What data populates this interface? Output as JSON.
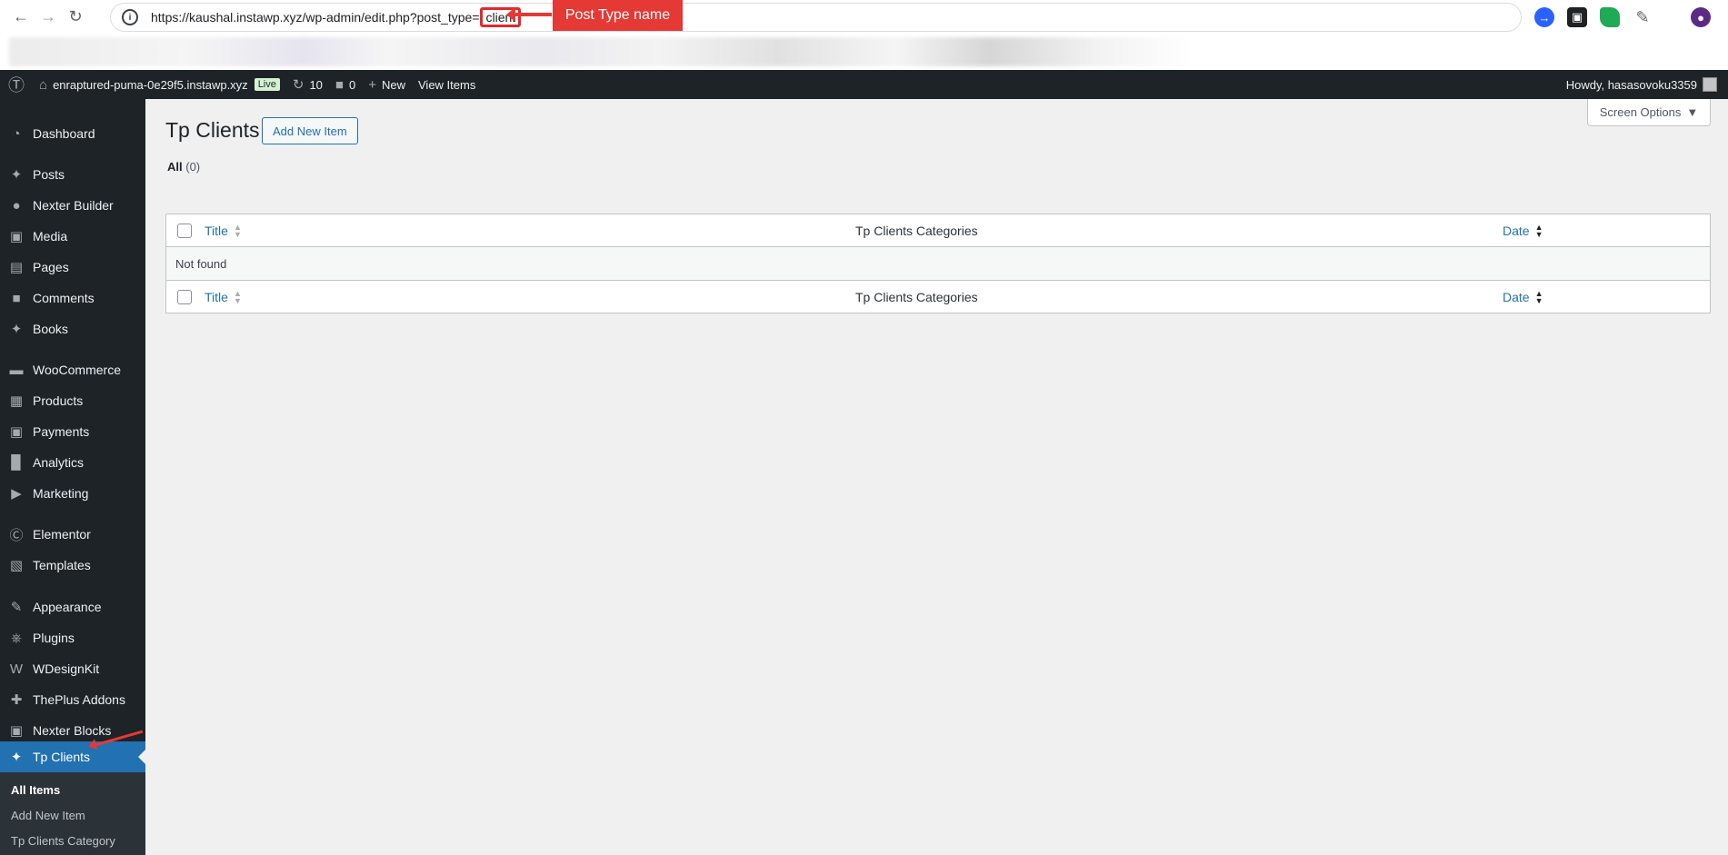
{
  "browser": {
    "url_prefix": "https://kaushal.instawp.xyz/wp-admin/edit.php?post_type=",
    "url_highlight": "client",
    "annotation_label": "Post Type name"
  },
  "adminbar": {
    "site_name": "enraptured-puma-0e29f5.instawp.xyz",
    "live_badge": "Live",
    "updates_count": "10",
    "comments_count": "0",
    "new_label": "New",
    "view_items_label": "View Items",
    "howdy": "Howdy, hasasovoku3359"
  },
  "sidebar": {
    "items": [
      {
        "label": "Dashboard",
        "icon": "dashboard-icon"
      },
      {
        "label": "Posts",
        "icon": "pin-icon"
      },
      {
        "label": "Nexter Builder",
        "icon": "nexter-icon"
      },
      {
        "label": "Media",
        "icon": "media-icon"
      },
      {
        "label": "Pages",
        "icon": "pages-icon"
      },
      {
        "label": "Comments",
        "icon": "comments-icon"
      },
      {
        "label": "Books",
        "icon": "pin-icon"
      },
      {
        "label": "WooCommerce",
        "icon": "woo-icon"
      },
      {
        "label": "Products",
        "icon": "products-icon"
      },
      {
        "label": "Payments",
        "icon": "payments-icon"
      },
      {
        "label": "Analytics",
        "icon": "analytics-icon"
      },
      {
        "label": "Marketing",
        "icon": "megaphone-icon"
      },
      {
        "label": "Elementor",
        "icon": "elementor-icon"
      },
      {
        "label": "Templates",
        "icon": "folder-icon"
      },
      {
        "label": "Appearance",
        "icon": "brush-icon"
      },
      {
        "label": "Plugins",
        "icon": "plugin-icon"
      },
      {
        "label": "WDesignKit",
        "icon": "wdesignkit-icon"
      },
      {
        "label": "ThePlus Addons",
        "icon": "theplus-icon"
      },
      {
        "label": "Nexter Blocks",
        "icon": "nexter-blocks-icon"
      },
      {
        "label": "Tp Clients",
        "icon": "pin-icon"
      }
    ],
    "submenu": [
      "All Items",
      "Add New Item",
      "Tp Clients Category"
    ]
  },
  "main": {
    "screen_options": "Screen Options",
    "page_title": "Tp Clients",
    "add_new_button": "Add New Item",
    "filter_all_label": "All",
    "filter_all_count": "(0)",
    "columns": {
      "title": "Title",
      "categories": "Tp Clients Categories",
      "date": "Date"
    },
    "empty_message": "Not found"
  }
}
